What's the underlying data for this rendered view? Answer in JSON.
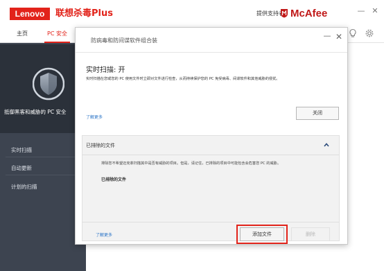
{
  "app": {
    "brand": "Lenovo",
    "product_name": "联想杀毒Plus",
    "provided_by": "提供支持者",
    "partner": "McAfee",
    "window_buttons": [
      "minimize",
      "close"
    ]
  },
  "tabs": [
    {
      "label": "主页",
      "active": false
    },
    {
      "label": "PC 安全",
      "active": true
    }
  ],
  "sidebar": {
    "status_text": "抵御黑客和威胁的 PC 安全",
    "items": [
      {
        "label": "实时扫描"
      },
      {
        "label": "自动更新"
      },
      {
        "label": "计划的扫描"
      }
    ]
  },
  "dialog": {
    "title": "防病毒和防间谍软件组合装",
    "realtime_heading": "实时扫描: 开",
    "realtime_description": "实时扫描在您或您的 PC 使用文件时立即对文件进行检查，从而持续保护您的 PC 免受病毒、间谍软件和其他威胁的侵扰。",
    "learn_more": "了解更多",
    "close_button": "关闭",
    "excluded_section": {
      "title": "已排除的文件",
      "expanded": true,
      "description": "排除您不希望迈克菲扫描其中是否有威胁的项目。但是，请记住，已排除的项目中可能包含会危害您 PC 的威胁。",
      "files_label": "已排除的文件",
      "learn_more": "了解更多",
      "add_button": "添加文件",
      "delete_button": "删除"
    }
  },
  "colors": {
    "brand_red": "#e2231a",
    "sidebar_bg": "#3d4450",
    "link_blue": "#2a74c7"
  }
}
